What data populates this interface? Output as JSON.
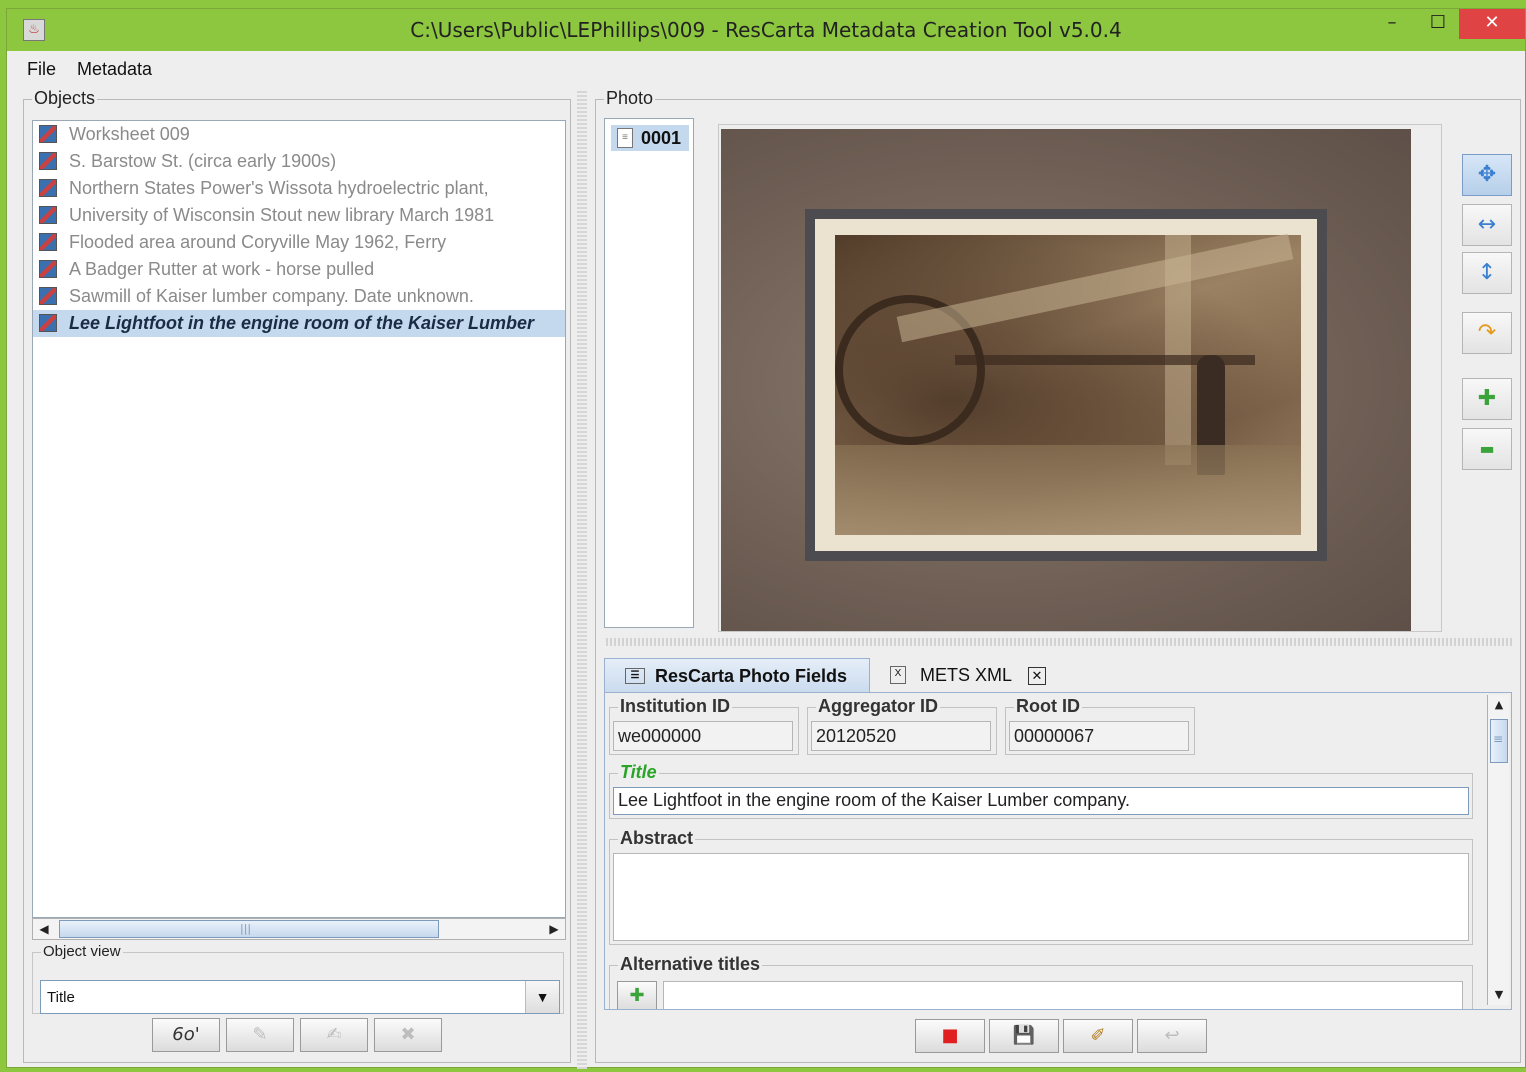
{
  "window": {
    "title": "C:\\Users\\Public\\LEPhillips\\009 - ResCarta Metadata Creation Tool v5.0.4",
    "minimize": "–",
    "maximize": "☐",
    "close": "✕"
  },
  "menu": {
    "file": "File",
    "metadata": "Metadata"
  },
  "objects": {
    "group_title": "Objects",
    "items": [
      {
        "label": "Worksheet 009"
      },
      {
        "label": "S. Barstow St. (circa early 1900s)"
      },
      {
        "label": "Northern States Power's Wissota hydroelectric plant,"
      },
      {
        "label": "University of Wisconsin Stout new library March 1981"
      },
      {
        "label": "Flooded area around Coryville May 1962, Ferry"
      },
      {
        "label": "A Badger Rutter at work - horse pulled"
      },
      {
        "label": "Sawmill of Kaiser lumber company. Date unknown."
      },
      {
        "label": "Lee Lightfoot in the engine room of the Kaiser Lumber"
      }
    ],
    "selected_index": 7,
    "scroll_thumb_glyph": "|||",
    "object_view": {
      "group_title": "Object view",
      "selected": "Title"
    },
    "buttons": {
      "view": "6o'",
      "edit": "✎",
      "edit2": "✍",
      "delete": "✖"
    }
  },
  "photo": {
    "group_title": "Photo",
    "thumbs": [
      {
        "label": "0001"
      }
    ],
    "tools": {
      "pan": "✥",
      "fit_width": "↔",
      "fit_height": "↕",
      "rotate": "↷",
      "zoom_in": "✚",
      "zoom_out": "▬"
    },
    "tabs": [
      {
        "label": "ResCarta Photo Fields",
        "icon": "table-icon"
      },
      {
        "label": "METS XML",
        "icon": "xml-file-icon"
      }
    ],
    "tab_close": "✕",
    "fields": {
      "institution_id": {
        "label": "Institution ID",
        "value": "we000000"
      },
      "aggregator_id": {
        "label": "Aggregator ID",
        "value": "20120520"
      },
      "root_id": {
        "label": "Root ID",
        "value": "00000067"
      },
      "title": {
        "label": "Title",
        "value": "Lee Lightfoot in the engine room of the Kaiser Lumber company."
      },
      "abstract": {
        "label": "Abstract",
        "value": ""
      },
      "alternative_titles": {
        "label": "Alternative titles",
        "value": ""
      }
    },
    "add_glyph": "✚",
    "scroll_up": "▲",
    "scroll_down": "▼",
    "grip_glyph": "≡"
  },
  "bottom_buttons": {
    "stop": "■",
    "save": "💾",
    "apply": "✐",
    "undo": "↩"
  },
  "colors": {
    "title_bar": "#8dc63f",
    "selection": "#c5d9ee",
    "required_label": "#2aa52a",
    "close_button": "#e04343"
  }
}
